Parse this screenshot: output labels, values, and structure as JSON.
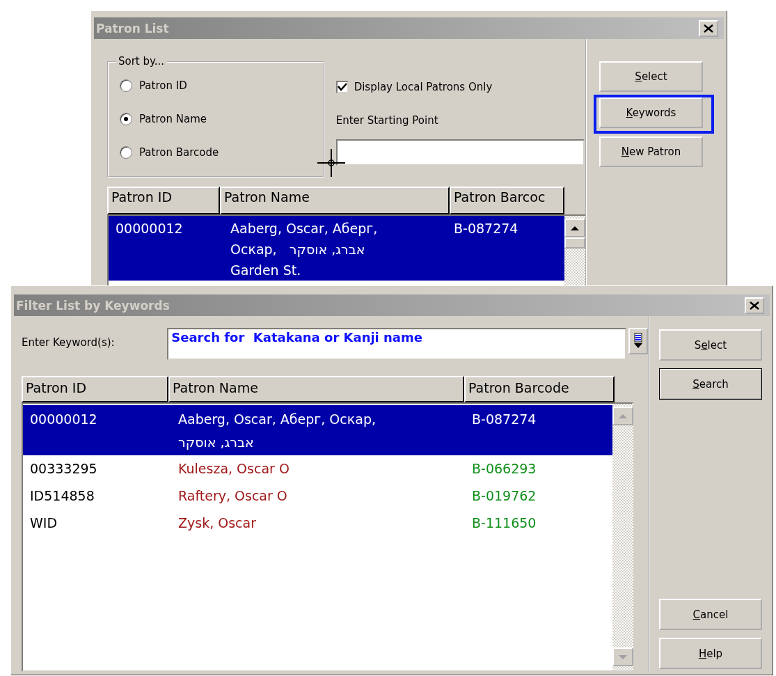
{
  "patron_list": {
    "title": "Patron List",
    "sort_by": {
      "legend": "Sort by...",
      "options": [
        {
          "label": "Patron ID",
          "selected": false
        },
        {
          "label": "Patron Name",
          "selected": true
        },
        {
          "label": "Patron Barcode",
          "selected": false
        }
      ]
    },
    "local_only": {
      "label": "Display Local Patrons Only",
      "checked": true
    },
    "starting_point": {
      "label": "Enter Starting Point"
    },
    "table": {
      "columns": [
        "Patron ID",
        "Patron Name",
        "Patron Barcoc"
      ],
      "rows": [
        {
          "selected": true,
          "id": "00000012",
          "name": [
            "Aaberg, Oscar, Аберг,",
            "Оскар,   אברג, אוסקר",
            "Garden St."
          ],
          "barcode": "B-087274"
        }
      ]
    },
    "buttons": [
      {
        "key": "S",
        "post": "elect",
        "highlighted": false
      },
      {
        "key": "K",
        "post": "eywords",
        "highlighted": true
      },
      {
        "key": "N",
        "post": "ew Patron",
        "highlighted": false
      }
    ]
  },
  "filter_dialog": {
    "title": "Filter List by Keywords",
    "keyword_label": "Enter Keyword(s):",
    "keyword_value": "Search for  Katakana or Kanji name",
    "table": {
      "columns": [
        "Patron ID",
        "Patron Name",
        "Patron Barcode"
      ],
      "rows": [
        {
          "selected": true,
          "id": "00000012",
          "name": [
            "Aaberg, Oscar, Аберг, Оскар,",
            "אברג, אוסקר"
          ],
          "barcode": "B-087274"
        },
        {
          "selected": false,
          "id": "00333295",
          "name": [
            "Kulesza, Oscar O"
          ],
          "barcode": "B-066293"
        },
        {
          "selected": false,
          "id": "ID514858",
          "name": [
            "Raftery, Oscar O"
          ],
          "barcode": "B-019762"
        },
        {
          "selected": false,
          "id": "WID",
          "name": [
            "Zysk, Oscar"
          ],
          "barcode": "B-111650"
        }
      ]
    },
    "buttons_top": [
      {
        "pre": "S",
        "key": "e",
        "post": "lect",
        "default": false
      },
      {
        "key": "S",
        "post": "earch",
        "default": true
      }
    ],
    "buttons_bottom": [
      {
        "key": "C",
        "post": "ancel",
        "default": false
      },
      {
        "key": "H",
        "post": "elp",
        "default": false
      }
    ]
  }
}
